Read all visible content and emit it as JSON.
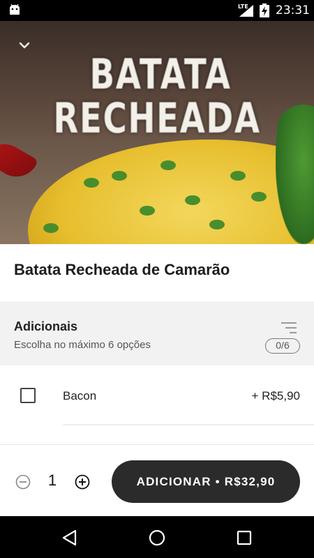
{
  "status_bar": {
    "network_label": "LTE",
    "time": "23:31",
    "icons": [
      "android-debug-icon",
      "lte-signal-icon",
      "battery-charging-icon"
    ]
  },
  "hero": {
    "title_line1": "BATATA",
    "title_line2": "RECHEADA",
    "back_icon": "chevron-down-icon"
  },
  "product": {
    "name": "Batata Recheada de Camarão"
  },
  "addons_section": {
    "title": "Adicionais",
    "subtitle": "Escolha no máximo 6 opções",
    "counter": "0/6",
    "filter_icon": "filter-lines-icon"
  },
  "options": [
    {
      "label": "Bacon",
      "price": "+ R$5,90",
      "checked": false
    }
  ],
  "footer": {
    "quantity": "1",
    "add_button_label": "ADICIONAR • R$32,90",
    "minus_icon": "minus-circle-icon",
    "plus_icon": "plus-circle-icon"
  },
  "nav_bar": {
    "icons": [
      "back-triangle-icon",
      "home-circle-icon",
      "recents-square-icon"
    ]
  },
  "colors": {
    "primary_button": "#2b2b2b",
    "section_bg": "#f2f2f2",
    "status_bar_bg": "#000000"
  }
}
